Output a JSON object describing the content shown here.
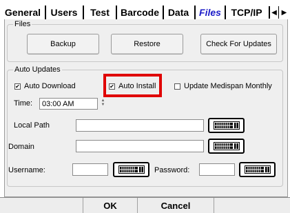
{
  "tabs": [
    {
      "label": "General",
      "active": false
    },
    {
      "label": "Users",
      "active": false
    },
    {
      "label": "Test",
      "active": false
    },
    {
      "label": "Barcode",
      "active": false
    },
    {
      "label": "Data",
      "active": false
    },
    {
      "label": "Files",
      "active": true
    },
    {
      "label": "TCP/IP",
      "active": false
    }
  ],
  "tab_nav": {
    "left_icon": "arrow-left-icon",
    "right_icon": "arrow-right-icon"
  },
  "files_group": {
    "label": "Files",
    "backup_label": "Backup",
    "restore_label": "Restore",
    "check_updates_label": "Check For Updates"
  },
  "auto_updates": {
    "label": "Auto Updates",
    "auto_download": {
      "label": "Auto Download",
      "checked": true
    },
    "auto_install": {
      "label": "Auto Install",
      "checked": true
    },
    "update_medispan": {
      "label": "Update Medispan Monthly",
      "checked": false
    },
    "time_label": "Time:",
    "time_value": "03:00 AM",
    "local_path_label": "Local Path",
    "local_path_value": "",
    "domain_label": "Domain",
    "domain_value": "",
    "username_label": "Username:",
    "username_value": "",
    "password_label": "Password:",
    "password_value": "",
    "keyboard_icon": "keyboard-icon"
  },
  "bottom": {
    "ok_label": "OK",
    "cancel_label": "Cancel"
  },
  "colors": {
    "active_tab": "#1c1cc8",
    "highlight": "#e00000",
    "panel_bg": "#efefef"
  }
}
